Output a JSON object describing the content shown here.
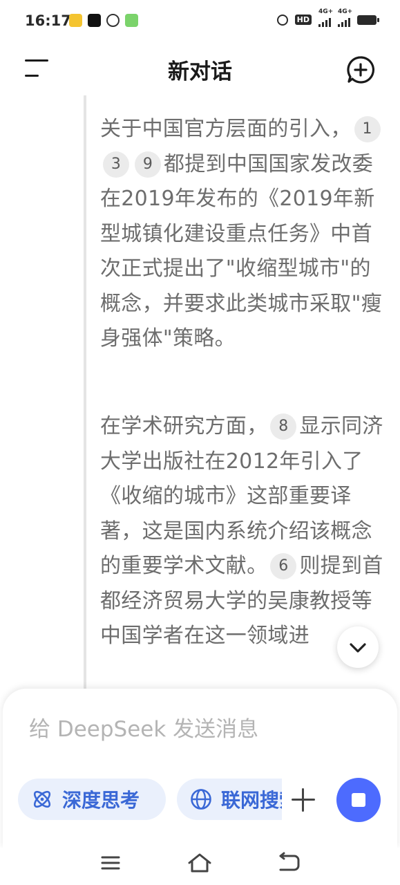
{
  "status_bar": {
    "time": "16:17",
    "notification_icons": [
      "app-notification-icon-1",
      "app-notification-icon-2",
      "app-notification-icon-3",
      "app-notification-icon-4"
    ],
    "hd_label": "HD",
    "network_1": "4G+",
    "network_2": "4G+"
  },
  "header": {
    "title": "新对话",
    "menu_icon": "menu-icon",
    "new_chat_icon": "new-chat-icon"
  },
  "message": {
    "paragraph_1": {
      "text_a": "关于中国官方层面的引入，",
      "citations": [
        "1",
        "3",
        "9"
      ],
      "text_b": "都提到中国国家发改委在2019年发布的《2019年新型城镇化建设重点任务》中首次正式提出了\"收缩型城市\"的概念，并要求此类城市采取\"瘦身强体\"策略。"
    },
    "paragraph_2": {
      "text_a": "在学术研究方面，",
      "citation_a": "8",
      "text_b": "显示同济大学出版社在2012年引入了《收缩的城市》这部重要译著，这是国内系统介绍该概念的重要学术文献。",
      "citation_b": "6",
      "text_c": "则提到首都经济贸易大学的吴康教授等中国学者在这一领域进"
    }
  },
  "composer": {
    "placeholder": "给 DeepSeek 发送消息",
    "deep_think_label": "深度思考",
    "web_search_label": "联网搜索"
  },
  "colors": {
    "accent": "#4d6bfe",
    "pill_bg": "#eaf0fc",
    "pill_text": "#3a68d6",
    "body_text": "#6d6d6d"
  }
}
